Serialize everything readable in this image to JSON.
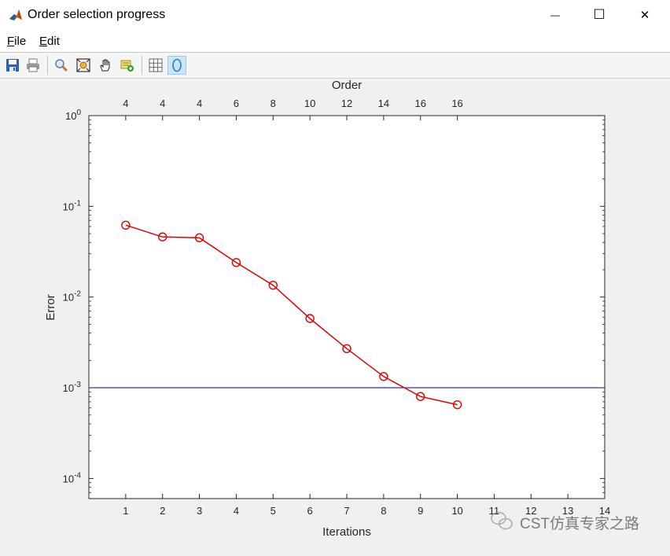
{
  "window": {
    "title": "Order selection progress",
    "minimize_glyph": "—",
    "maximize_glyph": "☐",
    "close_glyph": "✕"
  },
  "menu": {
    "file": {
      "accel": "F",
      "rest": "ile"
    },
    "edit": {
      "accel": "E",
      "rest": "dit"
    }
  },
  "toolbar": {
    "icons": [
      "save-icon",
      "print-icon",
      "zoom-in-icon",
      "zoom-fit-icon",
      "pan-hand-icon",
      "data-cursor-icon",
      "grid-icon",
      "ellipse-icon"
    ],
    "active": "ellipse-icon"
  },
  "colors": {
    "series": "#e00000",
    "threshold": "#000080",
    "axes": "#262626",
    "plot_bg": "#ffffff"
  },
  "chart_data": {
    "type": "line",
    "xlabel": "Iterations",
    "ylabel": "Error",
    "top_xlabel": "Order",
    "yscale": "log",
    "xlim": [
      0,
      14
    ],
    "ylim": [
      6e-05,
      1
    ],
    "xticks": [
      1,
      2,
      3,
      4,
      5,
      6,
      7,
      8,
      9,
      10,
      11,
      12,
      13,
      14
    ],
    "yticks": [
      {
        "value": 0.0001,
        "base": "10",
        "exp": "-4"
      },
      {
        "value": 0.001,
        "base": "10",
        "exp": "-3"
      },
      {
        "value": 0.01,
        "base": "10",
        "exp": "-2"
      },
      {
        "value": 0.1,
        "base": "10",
        "exp": "-1"
      },
      {
        "value": 1,
        "base": "10",
        "exp": "0"
      }
    ],
    "top_ticks": [
      {
        "x": 1,
        "label": "4"
      },
      {
        "x": 2,
        "label": "4"
      },
      {
        "x": 3,
        "label": "4"
      },
      {
        "x": 4,
        "label": "6"
      },
      {
        "x": 5,
        "label": "8"
      },
      {
        "x": 6,
        "label": "10"
      },
      {
        "x": 7,
        "label": "12"
      },
      {
        "x": 8,
        "label": "14"
      },
      {
        "x": 9,
        "label": "16"
      },
      {
        "x": 10,
        "label": "16"
      }
    ],
    "series": [
      {
        "marker": "circle",
        "x": [
          1,
          2,
          3,
          4,
          5,
          6,
          7,
          8,
          9,
          10
        ],
        "y": [
          0.062,
          0.046,
          0.045,
          0.024,
          0.0135,
          0.0058,
          0.0027,
          0.00133,
          0.0008,
          0.00065
        ]
      }
    ],
    "threshold": 0.001,
    "grid": false
  },
  "watermark": {
    "text": "CST仿真专家之路"
  }
}
